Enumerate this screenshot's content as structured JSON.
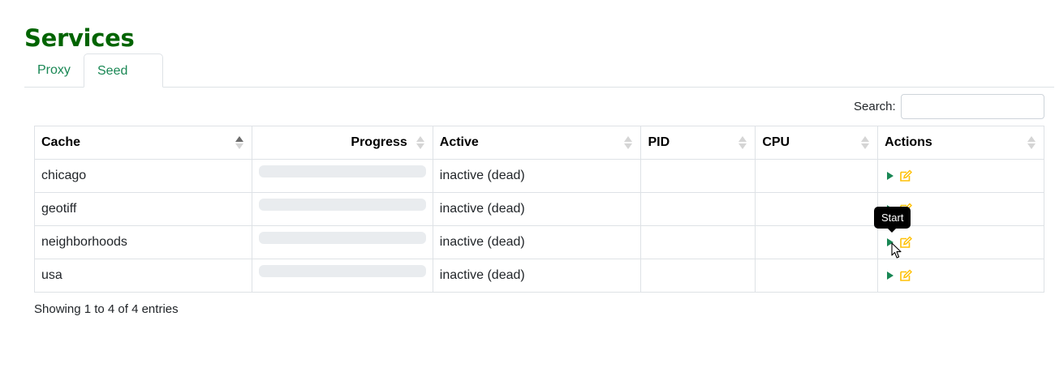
{
  "page_title": "Services",
  "tabs": [
    {
      "label": "Proxy",
      "active": false
    },
    {
      "label": "Seed",
      "active": true
    }
  ],
  "search": {
    "label": "Search:",
    "value": "",
    "placeholder": ""
  },
  "table": {
    "columns": [
      "Cache",
      "Progress",
      "Active",
      "PID",
      "CPU",
      "Actions"
    ],
    "sorted_column": "Cache",
    "sort_direction": "ascending",
    "rows": [
      {
        "cache": "chicago",
        "progress": 0,
        "active": "inactive (dead)",
        "pid": "",
        "cpu": ""
      },
      {
        "cache": "geotiff",
        "progress": 0,
        "active": "inactive (dead)",
        "pid": "",
        "cpu": ""
      },
      {
        "cache": "neighborhoods",
        "progress": 0,
        "active": "inactive (dead)",
        "pid": "",
        "cpu": ""
      },
      {
        "cache": "usa",
        "progress": 0,
        "active": "inactive (dead)",
        "pid": "",
        "cpu": ""
      }
    ]
  },
  "actions": {
    "play_icon": "play-icon",
    "edit_icon": "edit-icon"
  },
  "tooltip": "Start",
  "info": "Showing 1 to 4 of 4 entries",
  "colors": {
    "title": "#006400",
    "accent": "#198754",
    "edit": "#ffc107"
  }
}
